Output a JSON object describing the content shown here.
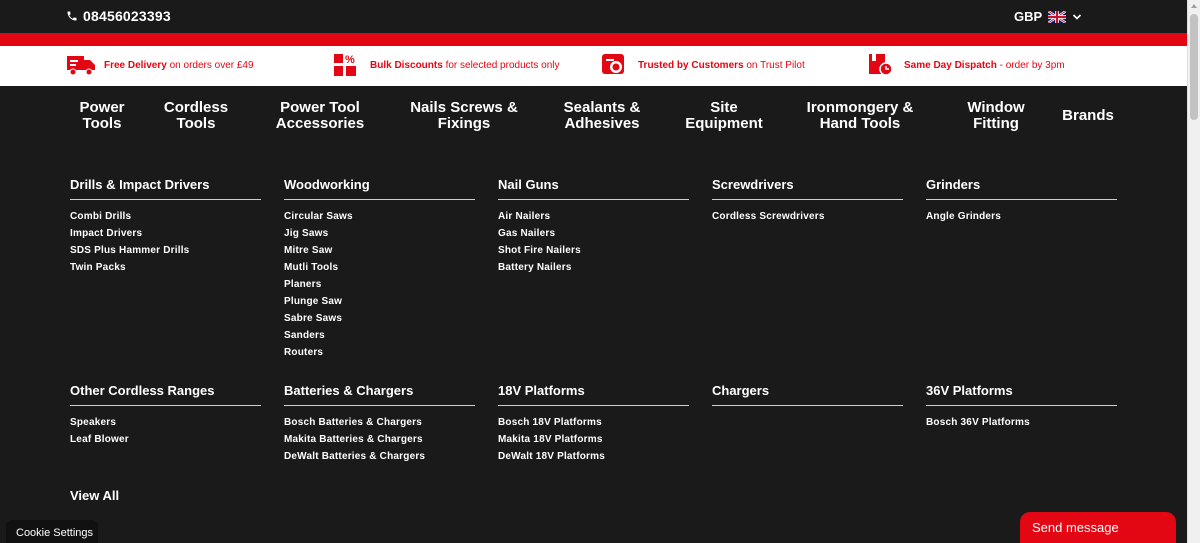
{
  "header": {
    "phone": "08456023393",
    "currency": "GBP"
  },
  "usp": [
    {
      "bold": "Free Delivery",
      "text": "on orders over £49",
      "icon": "delivery-truck-icon"
    },
    {
      "bold": "Bulk Discounts",
      "text": "for selected products only",
      "icon": "percent-boxes-icon"
    },
    {
      "bold": "Trusted by Customers",
      "text": "on Trust Pilot",
      "icon": "trust-badge-icon"
    },
    {
      "bold": "Same Day Dispatch",
      "text": "- order by 3pm",
      "icon": "dispatch-clock-icon"
    }
  ],
  "nav": [
    {
      "label": "Power\nTools"
    },
    {
      "label": "Cordless\nTools"
    },
    {
      "label": "Power Tool\nAccessories"
    },
    {
      "label": "Nails Screws &\nFixings"
    },
    {
      "label": "Sealants &\nAdhesives"
    },
    {
      "label": "Site\nEquipment"
    },
    {
      "label": "Ironmongery &\nHand Tools"
    },
    {
      "label": "Window\nFitting"
    },
    {
      "label": "Brands"
    }
  ],
  "mega": {
    "row1": [
      {
        "title": "Drills & Impact Drivers",
        "items": [
          "Combi Drills",
          "Impact Drivers",
          "SDS Plus Hammer Drills",
          "Twin Packs"
        ]
      },
      {
        "title": "Woodworking",
        "items": [
          "Circular Saws",
          "Jig Saws",
          "Mitre Saw",
          "Mutli Tools",
          "Planers",
          "Plunge Saw",
          "Sabre Saws",
          "Sanders",
          "Routers"
        ]
      },
      {
        "title": "Nail Guns",
        "items": [
          "Air Nailers",
          "Gas Nailers",
          "Shot Fire Nailers",
          "Battery Nailers"
        ]
      },
      {
        "title": "Screwdrivers",
        "items": [
          "Cordless Screwdrivers"
        ]
      },
      {
        "title": "Grinders",
        "items": [
          "Angle Grinders"
        ]
      }
    ],
    "row2": [
      {
        "title": "Other Cordless Ranges",
        "items": [
          "Speakers",
          "Leaf Blower"
        ]
      },
      {
        "title": "Batteries & Chargers",
        "items": [
          "Bosch Batteries & Chargers",
          "Makita Batteries & Chargers",
          "DeWalt Batteries & Chargers"
        ]
      },
      {
        "title": "18V Platforms",
        "items": [
          "Bosch 18V Platforms",
          "Makita 18V Platforms",
          "DeWalt 18V Platforms"
        ]
      },
      {
        "title": "Chargers",
        "items": []
      },
      {
        "title": "36V Platforms",
        "items": [
          "Bosch 36V Platforms"
        ]
      }
    ],
    "view_all": "View All"
  },
  "overlays": {
    "cookie": "Cookie Settings",
    "send": "Send message"
  },
  "colors": {
    "brand_red": "#e30613",
    "background": "#1a1a1a"
  }
}
